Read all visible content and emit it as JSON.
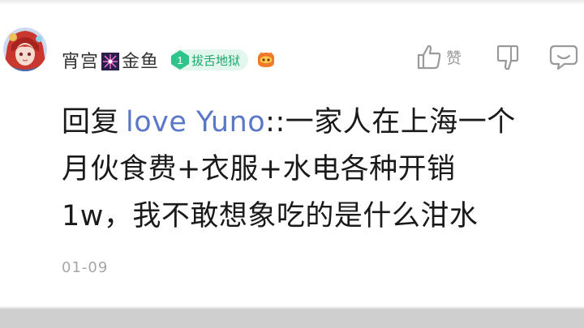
{
  "comment": {
    "username": "宵宫",
    "username_suffix": "金鱼",
    "level": "1",
    "level_title": "拔舌地狱",
    "like_label": "赞",
    "reply_prefix": "回复",
    "reply_target": "love Yuno",
    "lines": [
      "::一家人在上海一个",
      "月伙食费+衣服+水电各种开销",
      "1w，我不敢想象吃的是什么泔水"
    ],
    "timestamp": "01-09"
  },
  "colors": {
    "username": "#333333",
    "reply_target": "#5b78c8",
    "level_badge_bg": "#e4f7ee",
    "level_accent": "#17a86b",
    "icon_gray": "#9a9a9a",
    "timestamp": "#a6a6a6"
  },
  "icons": {
    "avatar": "anime-avatar-red-hair",
    "firework": "firework-emoji-icon",
    "level": "level-diamond-icon",
    "medal": "fan-medal-icon",
    "like": "thumbs-up-icon",
    "dislike": "thumbs-down-icon",
    "reply": "reply-bubble-icon"
  }
}
